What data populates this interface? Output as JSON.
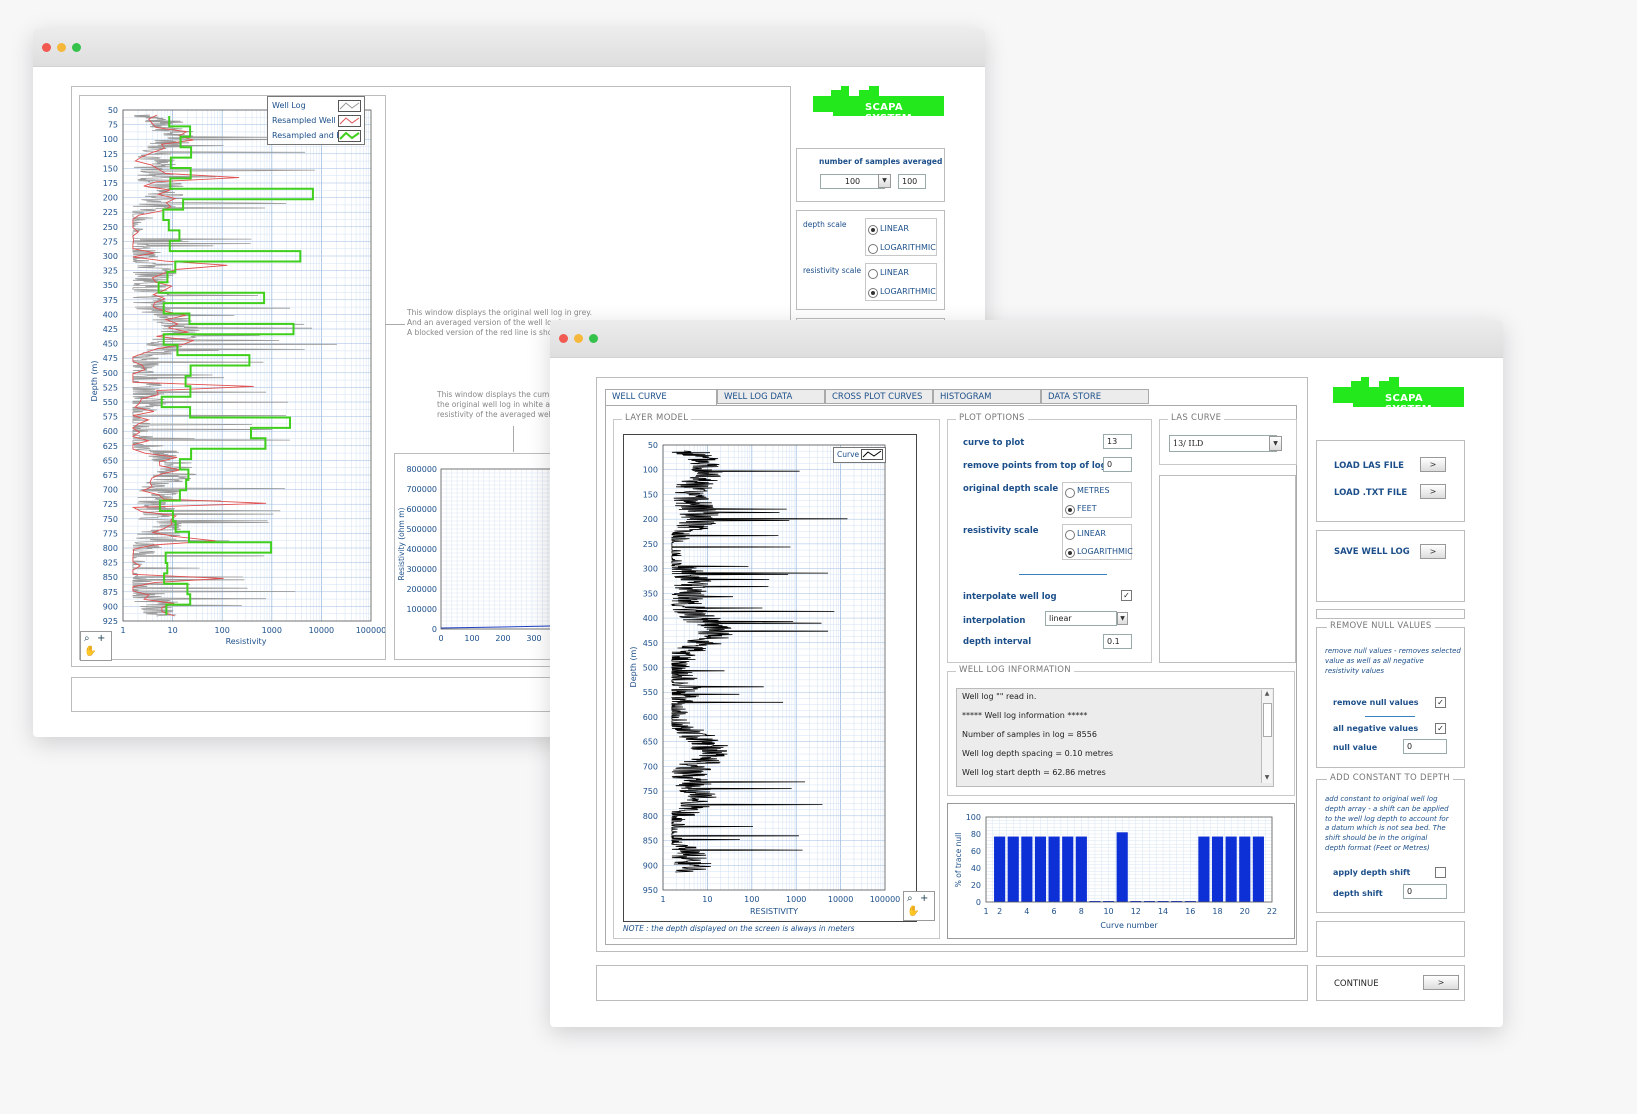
{
  "back_window": {
    "legend": [
      "Well Log",
      "Resampled Well Lo",
      "Resampled and Bl"
    ],
    "depth_axis_label": "Depth (m)",
    "x_axis_label": "Resistivity",
    "depth_ticks": [
      "50",
      "75",
      "100",
      "125",
      "150",
      "175",
      "200",
      "225",
      "250",
      "275",
      "300",
      "325",
      "350",
      "375",
      "400",
      "425",
      "450",
      "475",
      "500",
      "525",
      "550",
      "575",
      "600",
      "625",
      "650",
      "675",
      "700",
      "725",
      "750",
      "775",
      "800",
      "825",
      "850",
      "875",
      "900",
      "925"
    ],
    "x_ticks": [
      "1",
      "10",
      "100",
      "1000",
      "10000",
      "100000"
    ],
    "logo_text": "SCAPA SYSTEM",
    "samples_label": "number of samples averaged",
    "samples_select": "100",
    "samples_value": "100",
    "depth_scale_label": "depth scale",
    "resistivity_scale_label": "resistivity scale",
    "opt_linear": "LINEAR",
    "opt_log": "LOGARITHMIC",
    "note1": [
      "This window displays the original well log in grey.",
      "And an averaged version of the well log is",
      "A blocked version of the red line is shown"
    ],
    "note2": [
      "This window displays the cumula",
      "the original well log in white and",
      "resistivity of the averaged well lo"
    ],
    "cum_y_label": "Resistivity (ohm m)",
    "cum_y_ticks": [
      "800000",
      "700000",
      "600000",
      "500000",
      "400000",
      "300000",
      "200000",
      "100000",
      "0"
    ],
    "cum_x_ticks": [
      "0",
      "100",
      "200",
      "300"
    ]
  },
  "front_window": {
    "tabs": [
      "WELL CURVE",
      "WELL LOG DATA",
      "CROSS PLOT CURVES",
      "HISTOGRAM",
      "DATA STORE"
    ],
    "layer_model_title": "LAYER MODEL",
    "legend_curve": "Curve",
    "depth_axis_label": "Depth (m)",
    "x_axis_label": "RESISTIVITY",
    "depth_ticks": [
      "50",
      "100",
      "150",
      "200",
      "250",
      "300",
      "350",
      "400",
      "450",
      "500",
      "550",
      "600",
      "650",
      "700",
      "750",
      "800",
      "850",
      "900",
      "950"
    ],
    "x_ticks": [
      "1",
      "10",
      "100",
      "1000",
      "10000",
      "100000"
    ],
    "note": "NOTE : the depth displayed on the screen is always in meters",
    "plot_options_title": "PLOT OPTIONS",
    "curve_to_plot_label": "curve to plot",
    "curve_to_plot_value": "13",
    "remove_points_label": "remove points from top of log",
    "remove_points_value": "0",
    "original_depth_scale_label": "original depth scale",
    "opt_metres": "METRES",
    "opt_feet": "FEET",
    "resistivity_scale_label": "resistivity scale",
    "opt_linear": "LINEAR",
    "opt_log": "LOGARITHMIC",
    "interpolate_label": "interpolate well log",
    "interpolation_label": "interpolation",
    "interpolation_value": "linear",
    "depth_interval_label": "depth interval",
    "depth_interval_value": "0.1",
    "las_curve_title": "LAS CURVE",
    "las_curve_value": "13/ ILD",
    "info_title": "WELL LOG INFORMATION",
    "info_lines": [
      "Well log \"\" read in.",
      "*****  Well log information *****",
      "Number of samples in log = 8556",
      "Well log depth spacing =  0.10 metres",
      "Well log start depth =  62.86 metres"
    ],
    "hist_y_label": "% of trace null",
    "hist_x_label": "Curve number",
    "hist_y_ticks": [
      "100",
      "80",
      "60",
      "40",
      "20",
      "0"
    ],
    "hist_x_ticks": [
      "1",
      "2",
      "4",
      "6",
      "8",
      "10",
      "12",
      "14",
      "16",
      "18",
      "20",
      "22"
    ],
    "logo_text": "SCAPA SYSTEM",
    "load_las": "LOAD LAS FILE",
    "load_txt": "LOAD .TXT FILE",
    "save_well_log": "SAVE WELL LOG",
    "arrow": ">",
    "remove_null_title": "REMOVE NULL VALUES",
    "remove_null_desc": [
      "remove null values - removes selected",
      "value as well as all negative",
      "resistivity values"
    ],
    "remove_null_label": "remove null values",
    "all_negative_label": "all negative values",
    "null_value_label": "null value",
    "null_value": "0",
    "add_constant_title": "ADD CONSTANT TO DEPTH",
    "add_constant_desc": [
      "add constant to original well log",
      "depth array - a shift can be applied",
      "to the well log depth to account for",
      "a datum which is not sea bed. The",
      "shift should be in the original",
      "depth format (Feet or Metres)"
    ],
    "apply_shift_label": "apply depth shift",
    "depth_shift_label": "depth shift",
    "depth_shift_value": "0",
    "continue_label": "CONTINUE"
  },
  "chart_data": {
    "type": "bar",
    "xlabel": "Curve number",
    "ylabel": "% of trace null",
    "ylim": [
      0,
      100
    ],
    "xlim": [
      1,
      22
    ],
    "x": [
      2,
      3,
      4,
      5,
      6,
      7,
      8,
      9,
      10,
      11,
      12,
      13,
      14,
      15,
      16,
      17,
      18,
      19,
      20,
      21
    ],
    "values": [
      77,
      77,
      77,
      77,
      77,
      77,
      77,
      0,
      0,
      82,
      0,
      0,
      0,
      0,
      0,
      77,
      77,
      77,
      77,
      77
    ],
    "color": "#0d2fd6"
  },
  "colors": {
    "brand_green": "#22e81c",
    "well_log_grey": "#9a9a9a",
    "resampled_red": "#e05050",
    "blocked_green": "#3fcf1c",
    "accent_blue": "#1c4f8a"
  }
}
